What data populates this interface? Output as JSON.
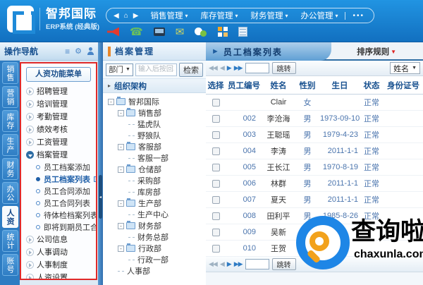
{
  "header": {
    "logo": {
      "title": "智邦国际",
      "subtitle": "ERP系统 (经典版)"
    },
    "nav": {
      "menus": [
        {
          "label": "销售管理"
        },
        {
          "label": "库存管理"
        },
        {
          "label": "财务管理"
        },
        {
          "label": "办公管理"
        }
      ],
      "more": "•••"
    },
    "toolbar_icons": [
      "megaphone-icon",
      "phone-icon",
      "laptop-icon",
      "mail-icon",
      "chat-icon",
      "apps-icon",
      "document-icon"
    ]
  },
  "sidebar": {
    "title": "操作导航",
    "tabs": [
      {
        "label": "销售"
      },
      {
        "label": "营销"
      },
      {
        "label": "库存"
      },
      {
        "label": "生产"
      },
      {
        "label": "财务"
      },
      {
        "label": "办公"
      },
      {
        "label": "人资"
      },
      {
        "label": "统计"
      },
      {
        "label": "账号"
      }
    ],
    "active_tab": "人资",
    "menu_button": "人资功能菜单",
    "items_top": [
      {
        "label": "招聘管理"
      },
      {
        "label": "培训管理"
      },
      {
        "label": "考勤管理"
      },
      {
        "label": "绩效考核"
      },
      {
        "label": "工资管理"
      },
      {
        "label": "档案管理"
      }
    ],
    "submenu": [
      {
        "label": "员工档案添加"
      },
      {
        "label": "员工档案列表"
      },
      {
        "label": "员工合同添加"
      },
      {
        "label": "员工合同列表"
      },
      {
        "label": "待体检档案列表"
      },
      {
        "label": "即将到期员工合同"
      }
    ],
    "active_item": "员工档案列表",
    "items_bottom": [
      {
        "label": "公司信息"
      },
      {
        "label": "人事调动"
      },
      {
        "label": "人事制度"
      },
      {
        "label": "人资设置"
      }
    ]
  },
  "tree_panel": {
    "title": "档案管理",
    "dept_label": "部门",
    "search_placeholder": "输入后按回车键",
    "search_button": "检索",
    "section_title": "组织架构",
    "nodes": [
      {
        "label": "智邦国际"
      },
      {
        "label": "销售部"
      },
      {
        "label": "猛虎队"
      },
      {
        "label": "野狼队"
      },
      {
        "label": "客服部"
      },
      {
        "label": "客服一部"
      },
      {
        "label": "仓储部"
      },
      {
        "label": "采购部"
      },
      {
        "label": "库房部"
      },
      {
        "label": "生产部"
      },
      {
        "label": "生产中心"
      },
      {
        "label": "财务部"
      },
      {
        "label": "财务总部"
      },
      {
        "label": "行政部"
      },
      {
        "label": "行政一部"
      },
      {
        "label": "人事部"
      }
    ]
  },
  "list_panel": {
    "title": "员工档案列表",
    "sort_rule": "排序规则",
    "jump_button": "跳转",
    "sort_field": "姓名",
    "columns": [
      "选择",
      "员工编号",
      "姓名",
      "性别",
      "生日",
      "状态",
      "身份证号"
    ],
    "rows": [
      {
        "no": "",
        "name": "Clair",
        "gender": "女",
        "birthday": "",
        "status": "正常",
        "id_card": ""
      },
      {
        "no": "002",
        "name": "李沧海",
        "gender": "男",
        "birthday": "1973-09-10",
        "status": "正常",
        "id_card": ""
      },
      {
        "no": "003",
        "name": "王聪瑶",
        "gender": "男",
        "birthday": "1979-4-23",
        "status": "正常",
        "id_card": ""
      },
      {
        "no": "004",
        "name": "李涛",
        "gender": "男",
        "birthday": "2011-1-1",
        "status": "正常",
        "id_card": ""
      },
      {
        "no": "005",
        "name": "王长江",
        "gender": "男",
        "birthday": "1970-8-19",
        "status": "正常",
        "id_card": ""
      },
      {
        "no": "006",
        "name": "林群",
        "gender": "男",
        "birthday": "2011-1-1",
        "status": "正常",
        "id_card": ""
      },
      {
        "no": "007",
        "name": "夏天",
        "gender": "男",
        "birthday": "2011-1-1",
        "status": "正常",
        "id_card": ""
      },
      {
        "no": "008",
        "name": "田利平",
        "gender": "男",
        "birthday": "1985-8-26",
        "status": "正常",
        "id_card": ""
      },
      {
        "no": "009",
        "name": "吴新",
        "gender": "",
        "birthday": "",
        "status": "",
        "id_card": ""
      },
      {
        "no": "010",
        "name": "王贺",
        "gender": "",
        "birthday": "",
        "status": "",
        "id_card": ""
      }
    ]
  },
  "watermark": {
    "text": "查询啦",
    "url": "chaxunla.com"
  },
  "colors": {
    "header_blue": "#1a82d2",
    "accent_orange": "#e8872a",
    "annotation_red": "#e02a2a",
    "active_link_blue": "#1f5fa8",
    "tab_blue": "#2d7cc2"
  }
}
